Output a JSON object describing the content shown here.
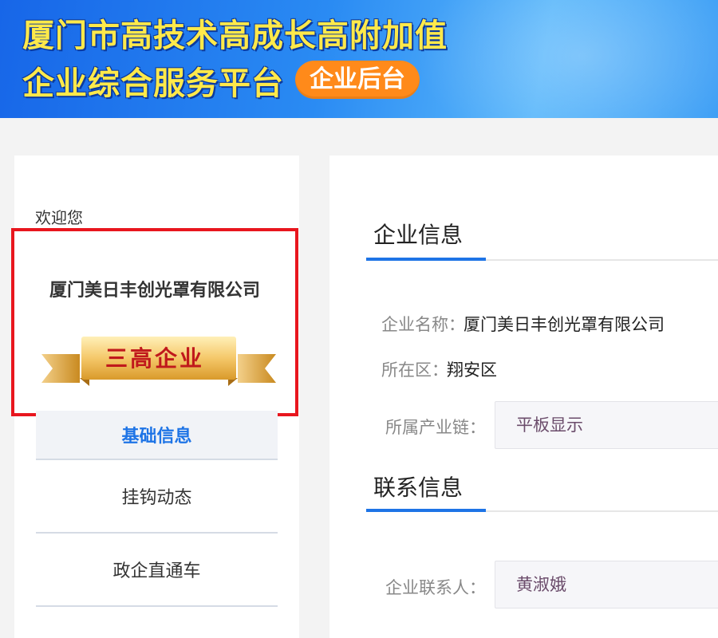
{
  "header": {
    "title_line1": "厦门市高技术高成长高附加值",
    "title_line2": "企业综合服务平台",
    "backend_badge": "企业后台"
  },
  "sidebar": {
    "welcome": "欢迎您",
    "company_name": "厦门美日丰创光罩有限公司",
    "company_badge": "三高企业",
    "menu": [
      {
        "label": "基础信息",
        "active": true
      },
      {
        "label": "挂钩动态",
        "active": false
      },
      {
        "label": "政企直通车",
        "active": false
      }
    ]
  },
  "main": {
    "company_section": {
      "title": "企业信息",
      "name_label": "企业名称：",
      "name_value": "厦门美日丰创光罩有限公司",
      "district_label": "所在区：",
      "district_value": "翔安区",
      "industry_label": "所属产业链：",
      "industry_value": "平板显示"
    },
    "contact_section": {
      "title": "联系信息",
      "contact_label": "企业联系人：",
      "contact_value": "黄淑娥"
    }
  },
  "colors": {
    "accent_blue": "#1e74e6",
    "title_yellow": "#ffe94a",
    "badge_orange": "#ff8a1a",
    "highlight_red": "#e8161e"
  }
}
